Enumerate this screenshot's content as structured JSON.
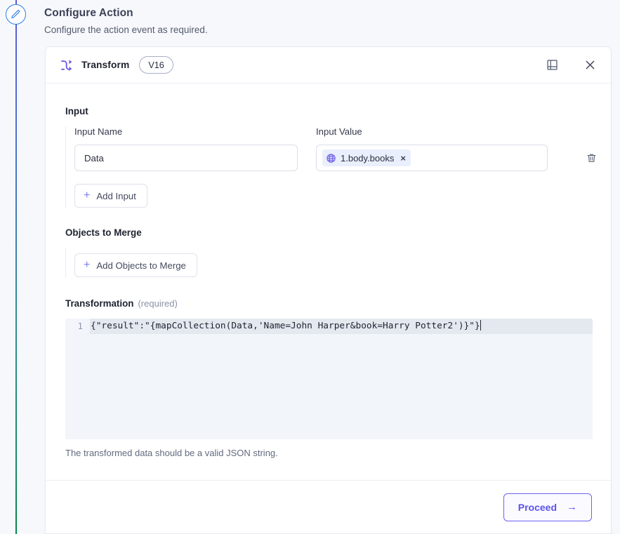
{
  "page": {
    "title": "Configure Action",
    "subtitle": "Configure the action event as required.",
    "step_icon": "pencil-icon"
  },
  "card": {
    "header": {
      "icon": "transform-icon",
      "name": "Transform",
      "version": "V16",
      "book_icon": "book-icon",
      "close_icon": "close-icon"
    },
    "input_section": {
      "title": "Input",
      "name_label": "Input Name",
      "value_label": "Input Value",
      "name_value": "Data",
      "token": {
        "icon": "globe-icon",
        "label": "1.body.books",
        "remove": "×"
      },
      "delete_icon": "trash-icon",
      "add_label": "Add Input",
      "add_icon": "plus-icon"
    },
    "merge_section": {
      "title": "Objects to Merge",
      "add_label": "Add Objects to Merge",
      "add_icon": "plus-icon"
    },
    "transformation_section": {
      "title": "Transformation",
      "required_note": "(required)",
      "line_number": "1",
      "code": "{\"result\":\"{mapCollection(Data,'Name=John Harper&book=Harry Potter2')}\"}",
      "helper": "The transformed data should be a valid JSON string."
    },
    "footer": {
      "proceed_label": "Proceed",
      "proceed_arrow": "→"
    }
  },
  "colors": {
    "accent": "#6c63f4",
    "token_bg": "#e9effc",
    "rail_top": "#5b5bd6",
    "rail_bottom": "#07864a",
    "node_border": "#2f7fe0",
    "editor_bg": "#f2f5fa",
    "active_line": "#e4e8ef"
  }
}
